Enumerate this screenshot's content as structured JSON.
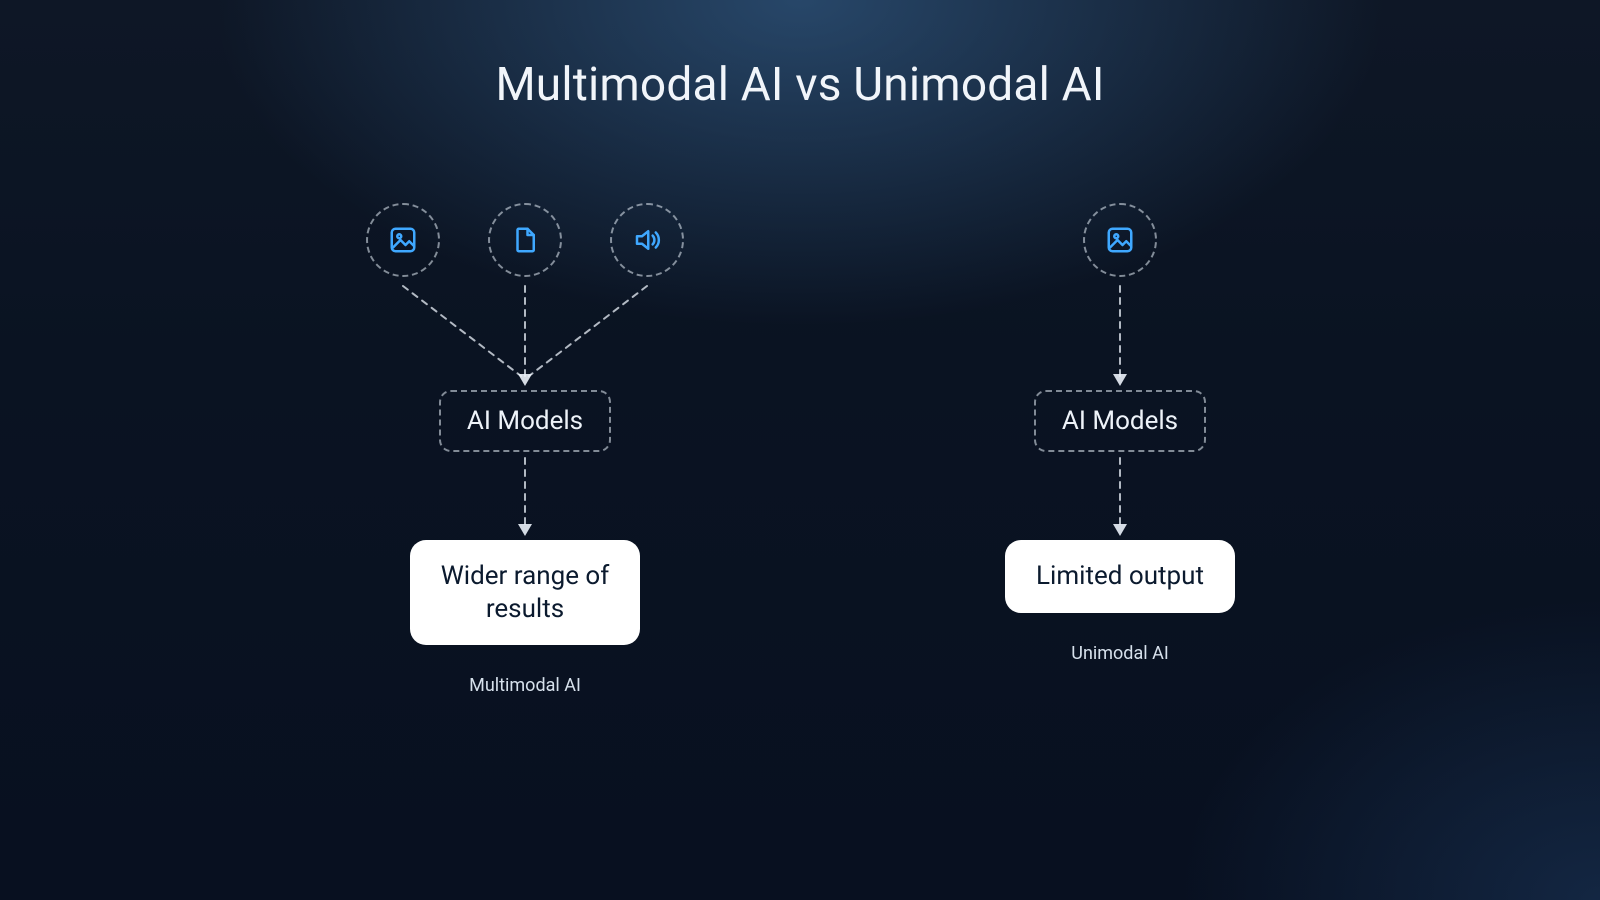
{
  "title": "Multimodal AI vs Unimodal AI",
  "left": {
    "inputs": [
      "image-icon",
      "file-icon",
      "audio-icon"
    ],
    "model_label": "AI Models",
    "output_label": "Wider range of results",
    "caption": "Multimodal AI"
  },
  "right": {
    "inputs": [
      "image-icon"
    ],
    "model_label": "AI Models",
    "output_label": "Limited output",
    "caption": "Unimodal AI"
  },
  "colors": {
    "icon": "#3fa8ff",
    "dashed": "rgba(230,238,248,0.55)",
    "text": "#e8eef5",
    "output_bg": "#ffffff",
    "output_fg": "#0b1a2e"
  }
}
